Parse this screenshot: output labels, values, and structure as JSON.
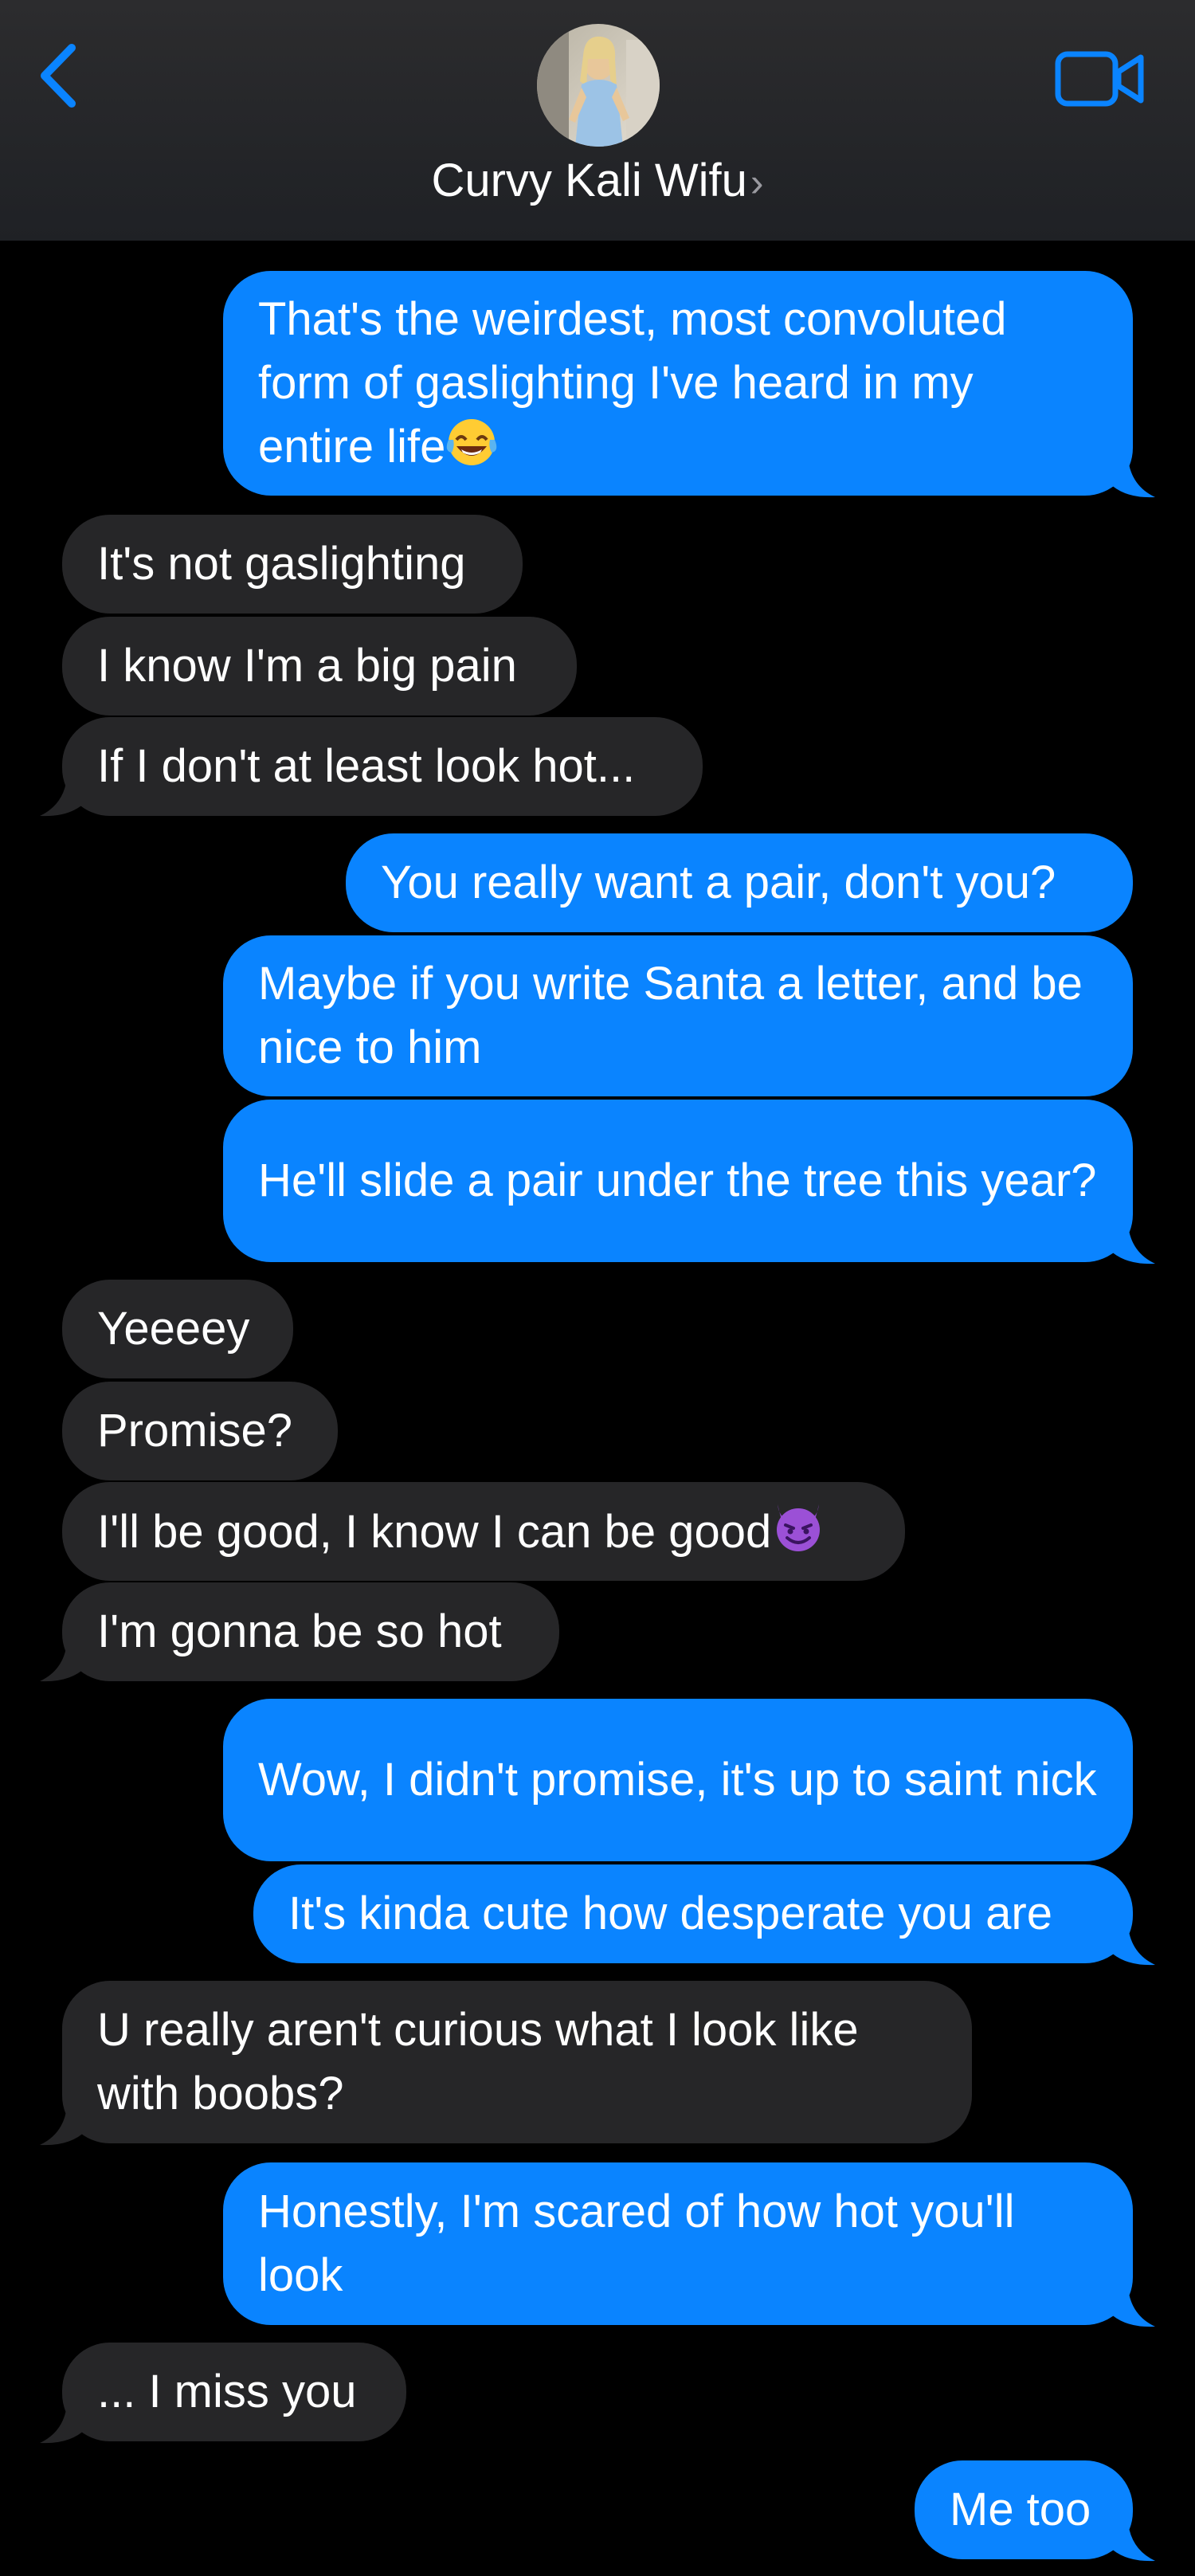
{
  "header": {
    "contact_name": "Curvy Kali Wifu",
    "chevron": "›",
    "back_icon": "chevron-left-icon",
    "video_icon": "video-camera-icon",
    "accent": "#0a84ff"
  },
  "colors": {
    "sent_bubble": "#0a84ff",
    "received_bubble": "#262628",
    "background": "#000000"
  },
  "messages": [
    {
      "from": "me",
      "text": "That's the weirdest, most convoluted form of gaslighting I've heard in my entire life",
      "emoji": "laughing-tears-emoji"
    },
    {
      "from": "them",
      "text": "It's not gaslighting"
    },
    {
      "from": "them",
      "text": "I know I'm a big pain"
    },
    {
      "from": "them",
      "text": "If I don't at least look hot..."
    },
    {
      "from": "me",
      "text": "You really want a pair, don't you?"
    },
    {
      "from": "me",
      "text": "Maybe if you write Santa a letter, and be nice to him"
    },
    {
      "from": "me",
      "text": "He'll slide a pair under the tree this year?"
    },
    {
      "from": "them",
      "text": "Yeeeey"
    },
    {
      "from": "them",
      "text": "Promise?"
    },
    {
      "from": "them",
      "text": "I'll be good, I know I can be good",
      "emoji": "smiling-devil-emoji"
    },
    {
      "from": "them",
      "text": "I'm gonna be so hot"
    },
    {
      "from": "me",
      "text": "Wow, I didn't promise, it's up to saint nick"
    },
    {
      "from": "me",
      "text": "It's kinda cute how desperate you are"
    },
    {
      "from": "them",
      "text": "U really aren't curious what I look like with boobs?"
    },
    {
      "from": "me",
      "text": "Honestly, I'm scared of how hot you'll look"
    },
    {
      "from": "them",
      "text": "... I miss you"
    },
    {
      "from": "me",
      "text": "Me too"
    }
  ]
}
